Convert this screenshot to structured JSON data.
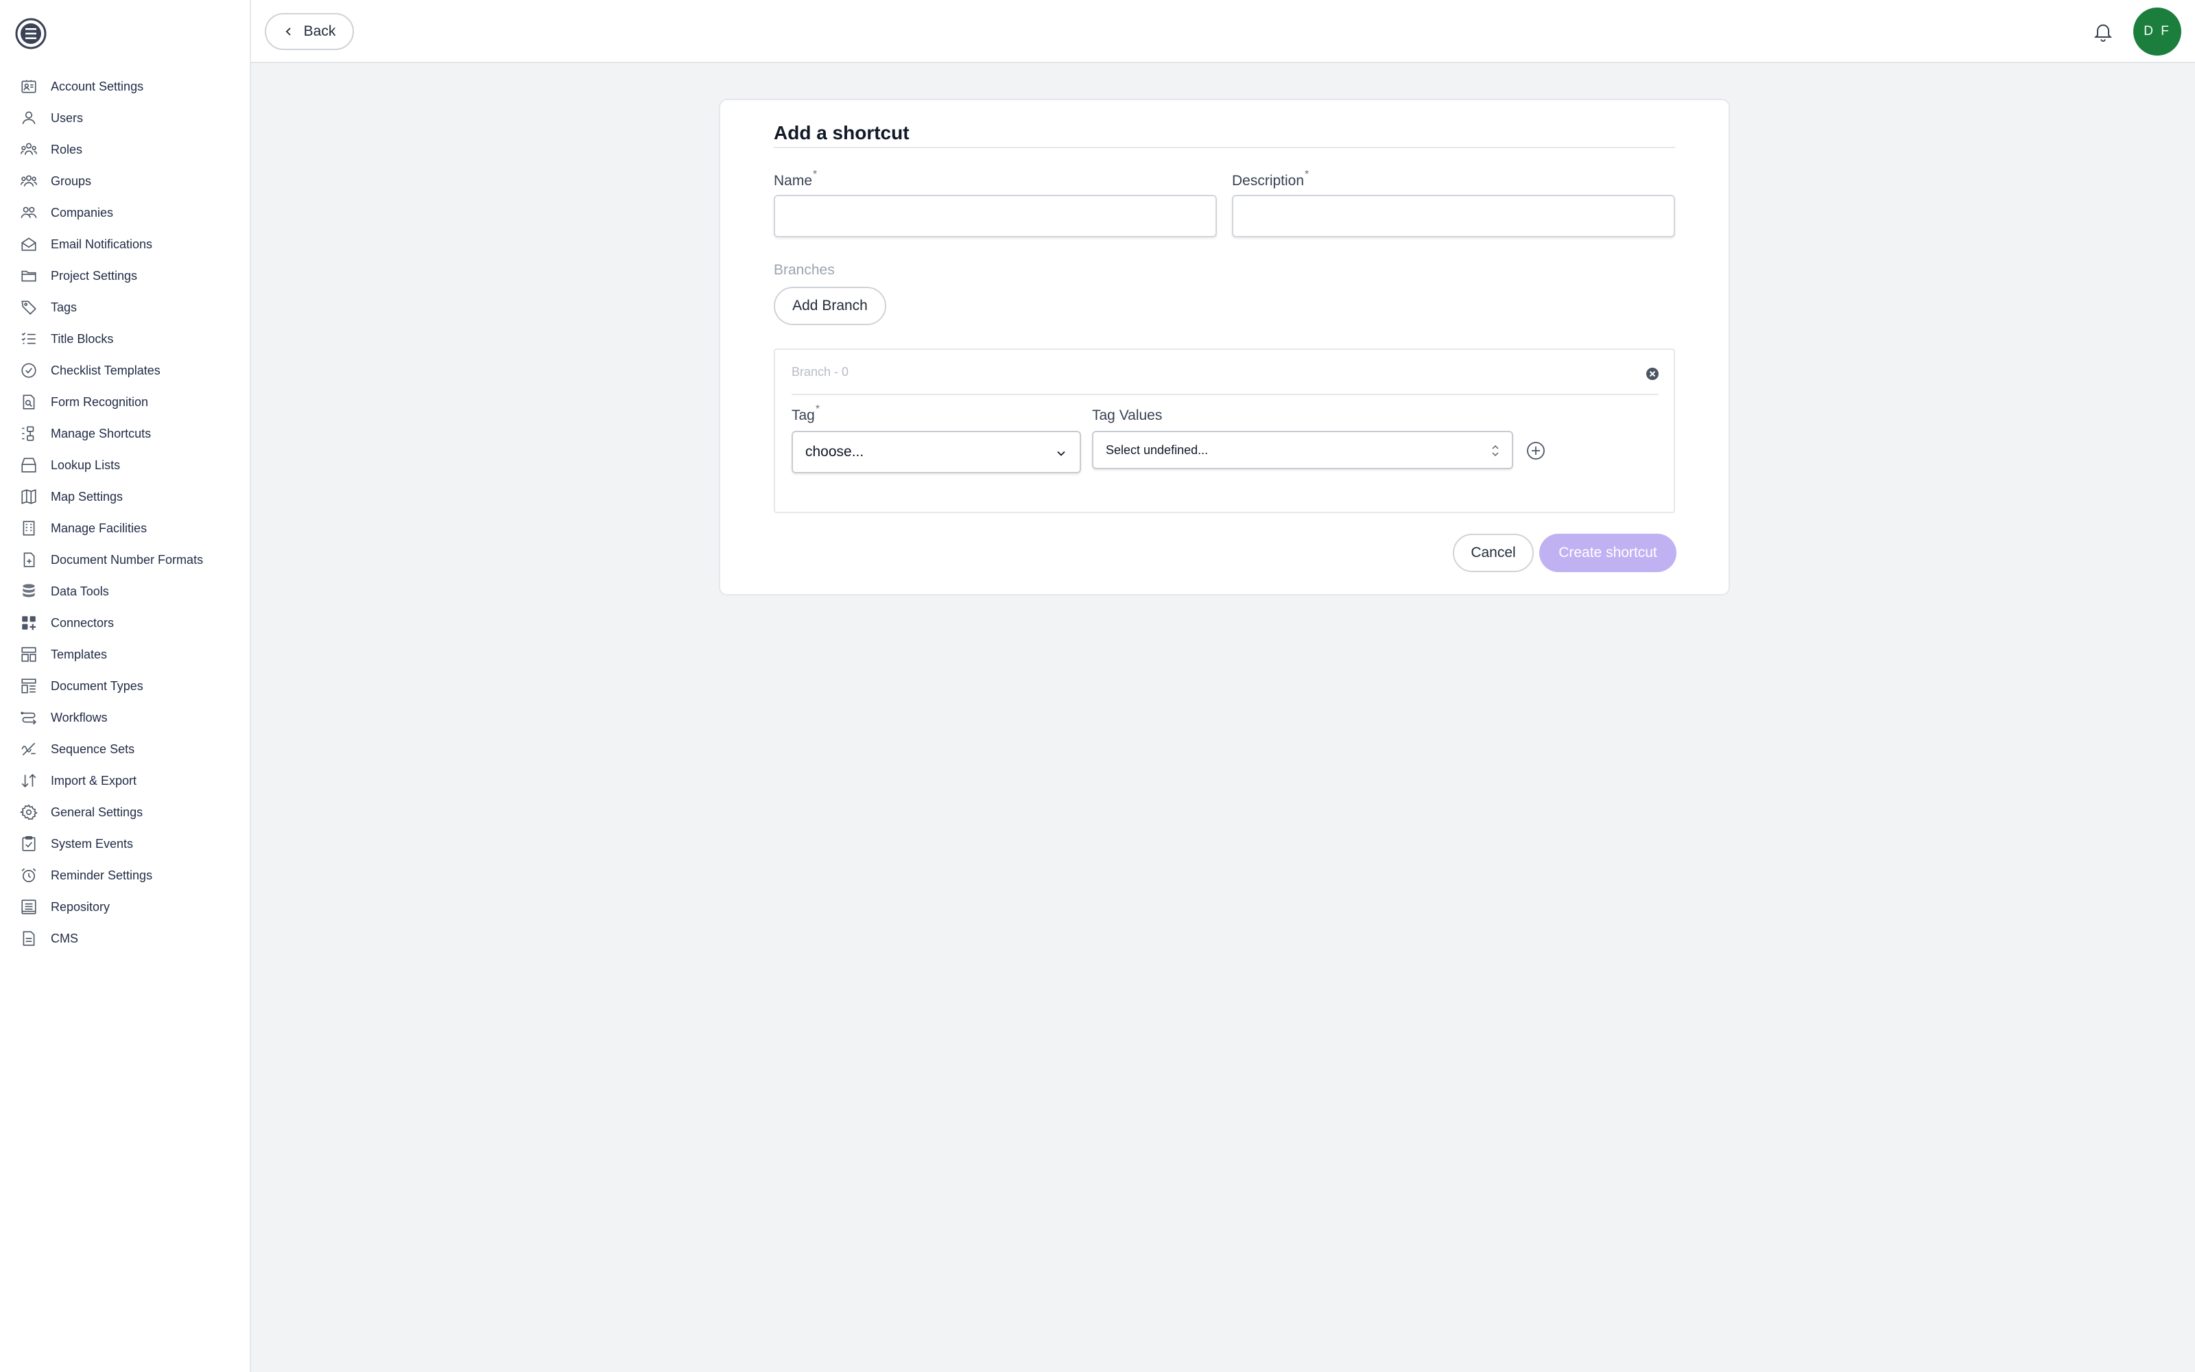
{
  "sidebar": {
    "items": [
      {
        "label": "Account Settings",
        "icon": "account-settings-icon"
      },
      {
        "label": "Users",
        "icon": "users-icon"
      },
      {
        "label": "Roles",
        "icon": "roles-icon"
      },
      {
        "label": "Groups",
        "icon": "groups-icon"
      },
      {
        "label": "Companies",
        "icon": "companies-icon"
      },
      {
        "label": "Email Notifications",
        "icon": "email-icon"
      },
      {
        "label": "Project Settings",
        "icon": "folder-icon"
      },
      {
        "label": "Tags",
        "icon": "tag-icon"
      },
      {
        "label": "Title Blocks",
        "icon": "list-icon"
      },
      {
        "label": "Checklist Templates",
        "icon": "check-circle-icon"
      },
      {
        "label": "Form Recognition",
        "icon": "document-search-icon"
      },
      {
        "label": "Manage Shortcuts",
        "icon": "shortcuts-icon"
      },
      {
        "label": "Lookup Lists",
        "icon": "archive-icon"
      },
      {
        "label": "Map Settings",
        "icon": "map-icon"
      },
      {
        "label": "Manage Facilities",
        "icon": "building-icon"
      },
      {
        "label": "Document Number Formats",
        "icon": "document-plus-icon"
      },
      {
        "label": "Data Tools",
        "icon": "database-icon"
      },
      {
        "label": "Connectors",
        "icon": "connectors-icon"
      },
      {
        "label": "Templates",
        "icon": "templates-icon"
      },
      {
        "label": "Document Types",
        "icon": "document-types-icon"
      },
      {
        "label": "Workflows",
        "icon": "workflow-icon"
      },
      {
        "label": "Sequence Sets",
        "icon": "sequence-icon"
      },
      {
        "label": "Import & Export",
        "icon": "import-export-icon"
      },
      {
        "label": "General Settings",
        "icon": "gear-icon"
      },
      {
        "label": "System Events",
        "icon": "clipboard-check-icon"
      },
      {
        "label": "Reminder Settings",
        "icon": "alarm-icon"
      },
      {
        "label": "Repository",
        "icon": "repository-icon"
      },
      {
        "label": "CMS",
        "icon": "file-text-icon"
      }
    ]
  },
  "header": {
    "back_label": "Back",
    "avatar_initials": "D F",
    "avatar_color": "#1b7e3c"
  },
  "form": {
    "title": "Add a shortcut",
    "name_label": "Name",
    "description_label": "Description",
    "required_mark": "*",
    "name_value": "",
    "description_value": "",
    "branches_label": "Branches",
    "add_branch_label": "Add Branch",
    "branch": {
      "title": "Branch - 0",
      "tag_label": "Tag",
      "tag_value": "choose...",
      "tag_values_label": "Tag Values",
      "tag_values_value": "Select undefined..."
    },
    "cancel_label": "Cancel",
    "create_label": "Create shortcut",
    "create_color": "#c0b1f2"
  }
}
